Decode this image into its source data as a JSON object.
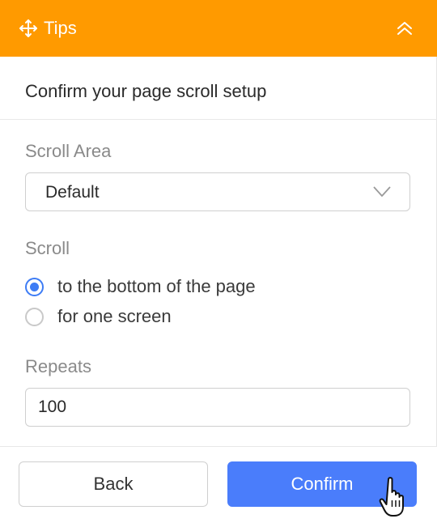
{
  "header": {
    "title": "Tips",
    "move_icon": "move-icon",
    "collapse_icon": "double-chevron-up-icon",
    "accent_color": "#ff9a00"
  },
  "subtitle": "Confirm your page scroll setup",
  "scroll_area": {
    "label": "Scroll Area",
    "value": "Default"
  },
  "scroll": {
    "label": "Scroll",
    "options": [
      {
        "label": "to the bottom of the page",
        "checked": true
      },
      {
        "label": "for one screen",
        "checked": false
      }
    ]
  },
  "repeats": {
    "label": "Repeats",
    "value": "100"
  },
  "footer": {
    "back_label": "Back",
    "confirm_label": "Confirm",
    "confirm_color": "#4a7dfb"
  }
}
